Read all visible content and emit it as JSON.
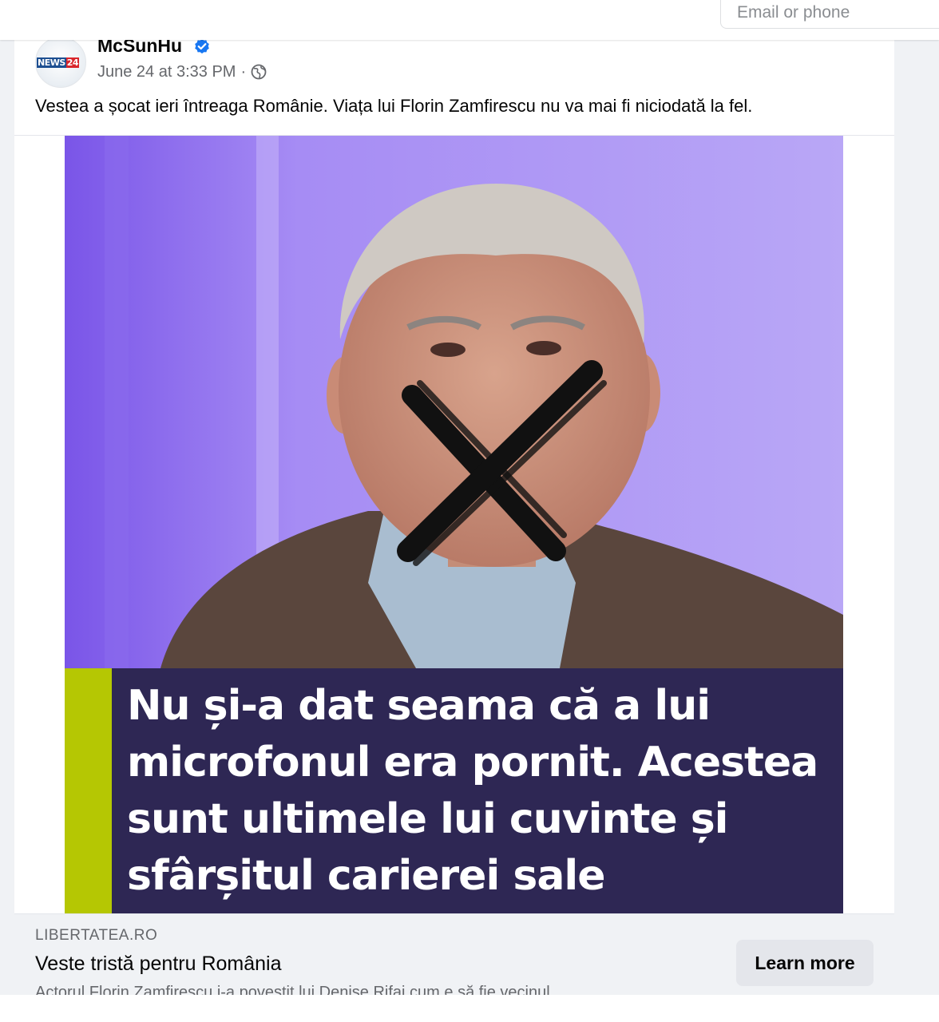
{
  "header": {
    "login_placeholder": "Email or phone"
  },
  "post": {
    "author": "McSunHu",
    "avatar_logo_part1": "NEWS",
    "avatar_logo_part2": "24",
    "timestamp": "June 24 at 3:33 PM",
    "separator": "·",
    "text": "Vestea a șocat ieri întreaga Românie. Viața lui Florin Zamfirescu nu va mai fi niciodată la fel.",
    "image_headline": "Nu și-a dat seama că a lui microfonul era pornit. Acestea sunt ultimele lui cuvinte și sfârșitul carierei sale"
  },
  "link_preview": {
    "domain": "LIBERTATEA.RO",
    "title": "Veste tristă pentru România",
    "description": "Actorul Florin Zamfirescu i-a povestit lui Denise Rifai cum e să fie vecinul",
    "button_label": "Learn more"
  },
  "colors": {
    "headline_bg": "#2e2754",
    "accent_bar": "#b5c703",
    "verified_badge": "#1877f2",
    "photo_background": "#a98ff0"
  },
  "icons": [
    "verified-badge-icon",
    "globe-icon",
    "x-mark-overlay"
  ]
}
